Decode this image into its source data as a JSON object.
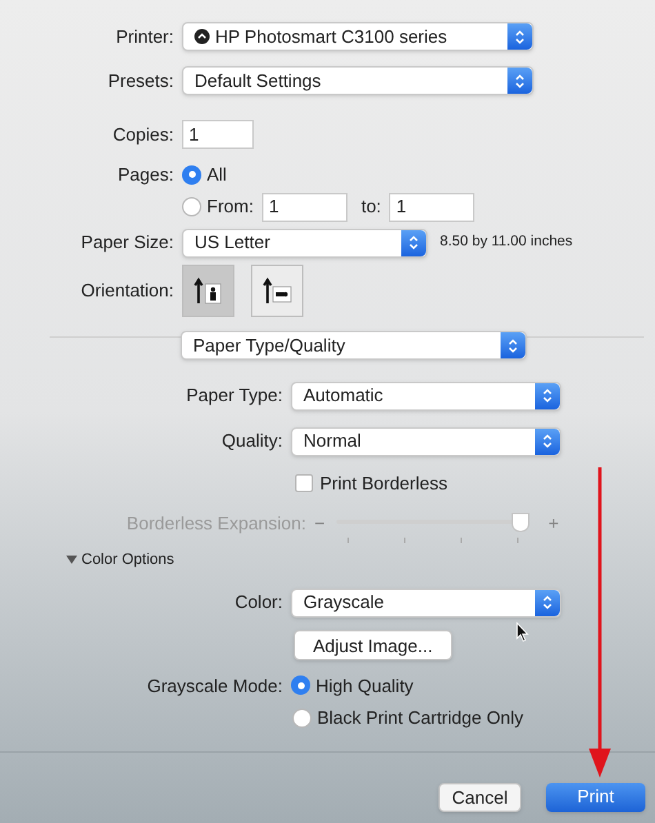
{
  "printer": {
    "label": "Printer:",
    "value": "HP Photosmart C3100 series"
  },
  "presets": {
    "label": "Presets:",
    "value": "Default Settings"
  },
  "copies": {
    "label": "Copies:",
    "value": "1"
  },
  "pages": {
    "label": "Pages:",
    "options": [
      {
        "label": "All",
        "selected": true
      },
      {
        "label": "From:",
        "selected": false
      }
    ],
    "from": "1",
    "to_label": "to:",
    "to": "1"
  },
  "paper_size": {
    "label": "Paper Size:",
    "value": "US Letter",
    "dimensions": "8.50 by 11.00 inches"
  },
  "orientation": {
    "label": "Orientation:",
    "options": [
      {
        "kind": "portrait",
        "selected": true
      },
      {
        "kind": "landscape",
        "selected": false
      }
    ]
  },
  "panel": {
    "value": "Paper Type/Quality"
  },
  "paper_type": {
    "label": "Paper Type:",
    "value": "Automatic"
  },
  "quality": {
    "label": "Quality:",
    "value": "Normal"
  },
  "print_borderless": {
    "label": "Print Borderless",
    "checked": false
  },
  "borderless_expansion": {
    "label": "Borderless Expansion:",
    "minus": "−",
    "plus": "+",
    "level": 0.95,
    "disabled": true
  },
  "color_options": {
    "label": "Color Options",
    "expanded": true
  },
  "color": {
    "label": "Color:",
    "value": "Grayscale"
  },
  "adjust_image": {
    "label": "Adjust Image..."
  },
  "grayscale_mode": {
    "label": "Grayscale Mode:",
    "options": [
      {
        "label": "High Quality",
        "selected": true
      },
      {
        "label": "Black Print Cartridge Only",
        "selected": false
      }
    ]
  },
  "buttons": [
    {
      "label": "Cancel",
      "kind": "normal"
    },
    {
      "label": "Print",
      "kind": "default"
    }
  ]
}
